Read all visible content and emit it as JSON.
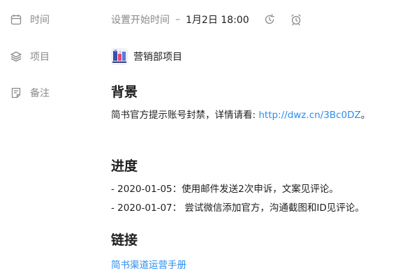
{
  "fields": {
    "time_label": "时间",
    "project_label": "项目",
    "notes_label": "备注"
  },
  "time": {
    "start_placeholder": "设置开始时间",
    "separator": "–",
    "end_value": "1月2日 18:00",
    "icons": [
      "repeat-icon",
      "alarm-clock-icon"
    ]
  },
  "project": {
    "name": "营销部项目",
    "avatar_icon": "project-avatar-icon"
  },
  "notes": {
    "background_heading": "背景",
    "background_text_prefix": "简书官方提示账号封禁，详情请看: ",
    "background_link": "http://dwz.cn/3Bc0DZ",
    "background_text_suffix": "。",
    "progress_heading": "进度",
    "progress_items": [
      "- 2020-01-05：使用邮件发送2次申诉，文案见评论。",
      "- 2020-01-07： 尝试微信添加官方，沟通截图和ID见评论。"
    ],
    "links_heading": "链接",
    "links": [
      "简书渠道运营手册"
    ]
  },
  "colors": {
    "label_gray": "#8a8a8a",
    "link_blue": "#2b8ef0",
    "text": "#1f1f1f"
  }
}
